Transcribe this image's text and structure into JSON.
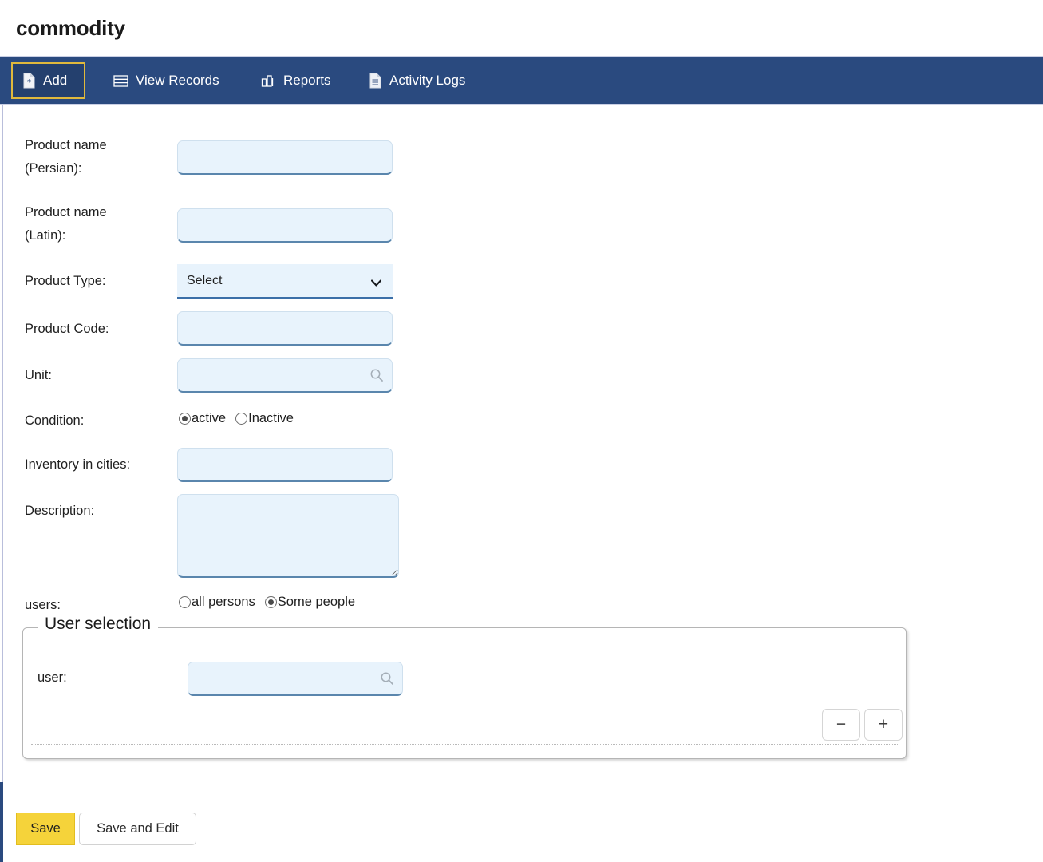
{
  "page": {
    "title": "commodity"
  },
  "tabs": [
    {
      "id": "add",
      "label": "Add",
      "icon": "document-add-icon",
      "active": true
    },
    {
      "id": "view",
      "label": "View Records",
      "icon": "table-rows-icon",
      "active": false
    },
    {
      "id": "reports",
      "label": "Reports",
      "icon": "bar-chart-icon",
      "active": false
    },
    {
      "id": "activity",
      "label": "Activity Logs",
      "icon": "document-list-icon",
      "active": false
    }
  ],
  "form": {
    "product_name_persian": {
      "label": "Product name\n(Persian):",
      "value": "",
      "placeholder": ""
    },
    "product_name_latin": {
      "label": "Product name\n(Latin):",
      "value": "",
      "placeholder": ""
    },
    "product_type": {
      "label": "Product Type:",
      "value": "Select",
      "options": [
        "Select"
      ]
    },
    "product_code": {
      "label": "Product Code:",
      "value": "",
      "placeholder": ""
    },
    "unit": {
      "label": "Unit:",
      "value": "",
      "placeholder": "",
      "icon": "search-icon"
    },
    "condition": {
      "label": "Condition:",
      "options": [
        {
          "label": "active",
          "selected": true
        },
        {
          "label": "Inactive",
          "selected": false
        }
      ]
    },
    "inventory_in_cities": {
      "label": "Inventory in cities:",
      "value": "",
      "placeholder": ""
    },
    "description": {
      "label": "Description:",
      "value": "",
      "placeholder": ""
    },
    "users": {
      "label": "users:",
      "options": [
        {
          "label": "all persons",
          "selected": false
        },
        {
          "label": "Some people",
          "selected": true
        }
      ]
    }
  },
  "user_selection": {
    "legend": "User selection",
    "user_field": {
      "label": "user:",
      "value": "",
      "placeholder": "",
      "icon": "search-icon"
    },
    "remove_label": "−",
    "add_label": "+"
  },
  "footer": {
    "save_label": "Save",
    "save_and_edit_label": "Save and Edit"
  },
  "colors": {
    "tabbar": "#2a4a7f",
    "tab_active_border": "#e0b93c",
    "tab_active_bg": "#24406e",
    "field_bg": "#e8f3fc",
    "field_underline": "#5a86ad",
    "save_button": "#f5d33a"
  }
}
